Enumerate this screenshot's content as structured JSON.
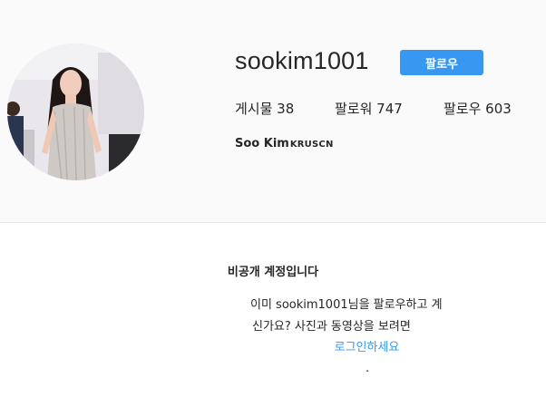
{
  "profile": {
    "username": "sookim1001",
    "follow_label": "팔로우",
    "stats": {
      "posts": "게시물 38",
      "followers": "팔로워 747",
      "following": "팔로우 603"
    },
    "full_name": "Soo Kim",
    "bio_tag": "KRUSCN",
    "avatar": "profile-photo"
  },
  "private_notice": {
    "title": "비공개 계정입니다",
    "line1": "이미 sookim1001님을 팔로우하고 계",
    "line2": "신가요? 사진과 동영상을 보려면",
    "login_link": "로그인하세요",
    "trailing": "."
  },
  "colors": {
    "accent": "#3897f0",
    "header_bg": "#fafafa",
    "text": "#262626"
  }
}
